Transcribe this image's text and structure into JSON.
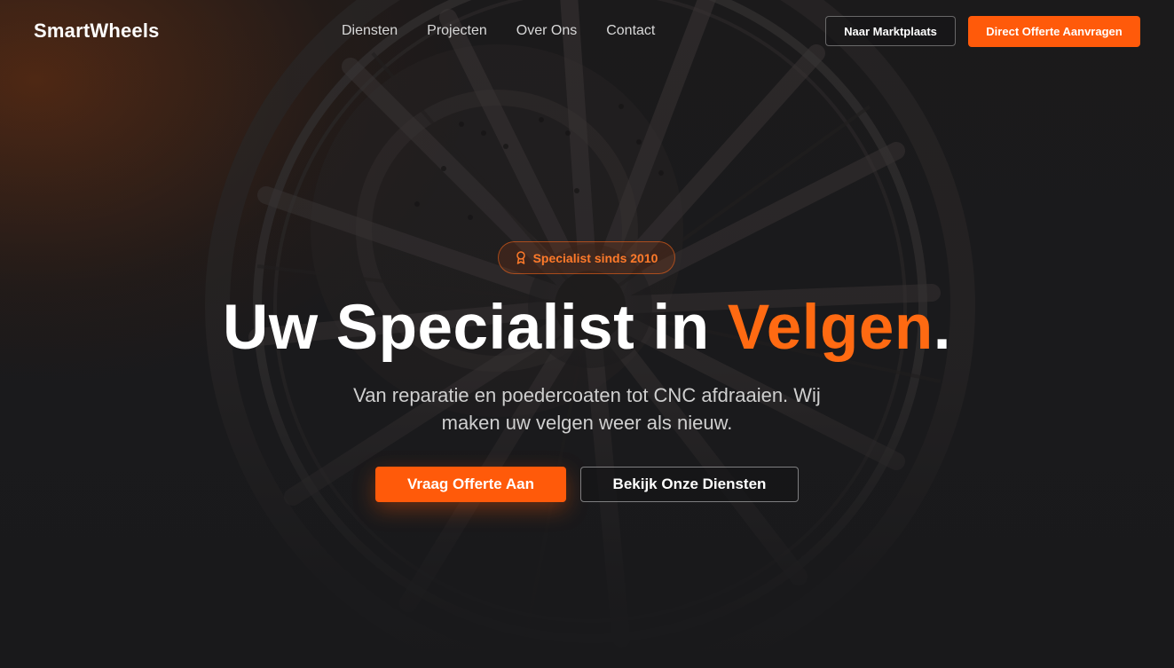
{
  "brand": {
    "name": "SmartWheels"
  },
  "nav": {
    "links": [
      "Diensten",
      "Projecten",
      "Over Ons",
      "Contact"
    ],
    "marketplace_button": "Naar Marktplaats",
    "quote_button": "Direct Offerte Aanvragen"
  },
  "hero": {
    "badge": {
      "icon": "award-icon",
      "label": "Specialist sinds 2010"
    },
    "headline_main": "Uw Specialist in ",
    "headline_accent": "Velgen",
    "headline_end": ".",
    "subtitle": "Van reparatie en poedercoaten tot CNC afdraaien. Wij maken uw velgen weer als nieuw.",
    "primary_cta": "Vraag Offerte Aan",
    "secondary_cta": "Bekijk Onze Diensten"
  },
  "colors": {
    "accent": "#ff5a0a",
    "background": "#19191b",
    "text": "#ffffff"
  }
}
